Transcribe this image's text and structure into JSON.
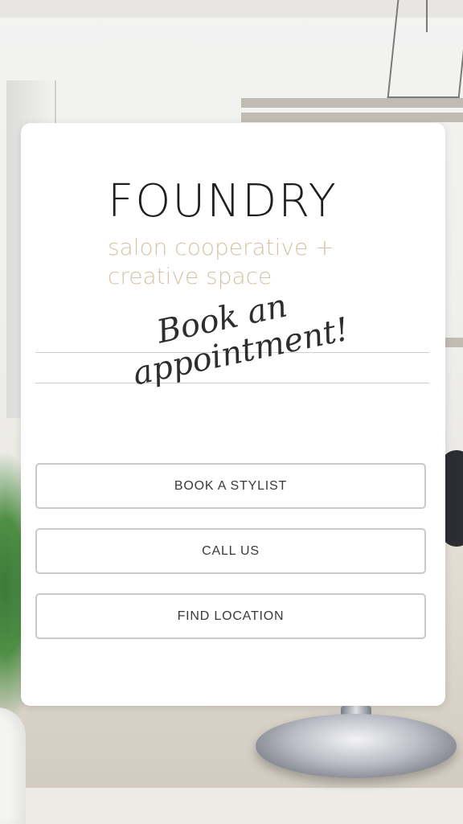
{
  "brand": {
    "title": "FOUNDRY",
    "subtitle_line1": "salon cooperative +",
    "subtitle_line2": "creative space",
    "accent_color": "#d6c3a6"
  },
  "tagline": {
    "line1": "Book an",
    "line2": "appointment!"
  },
  "actions": [
    {
      "label": "BOOK A STYLIST"
    },
    {
      "label": "CALL US"
    },
    {
      "label": "FIND LOCATION"
    }
  ]
}
